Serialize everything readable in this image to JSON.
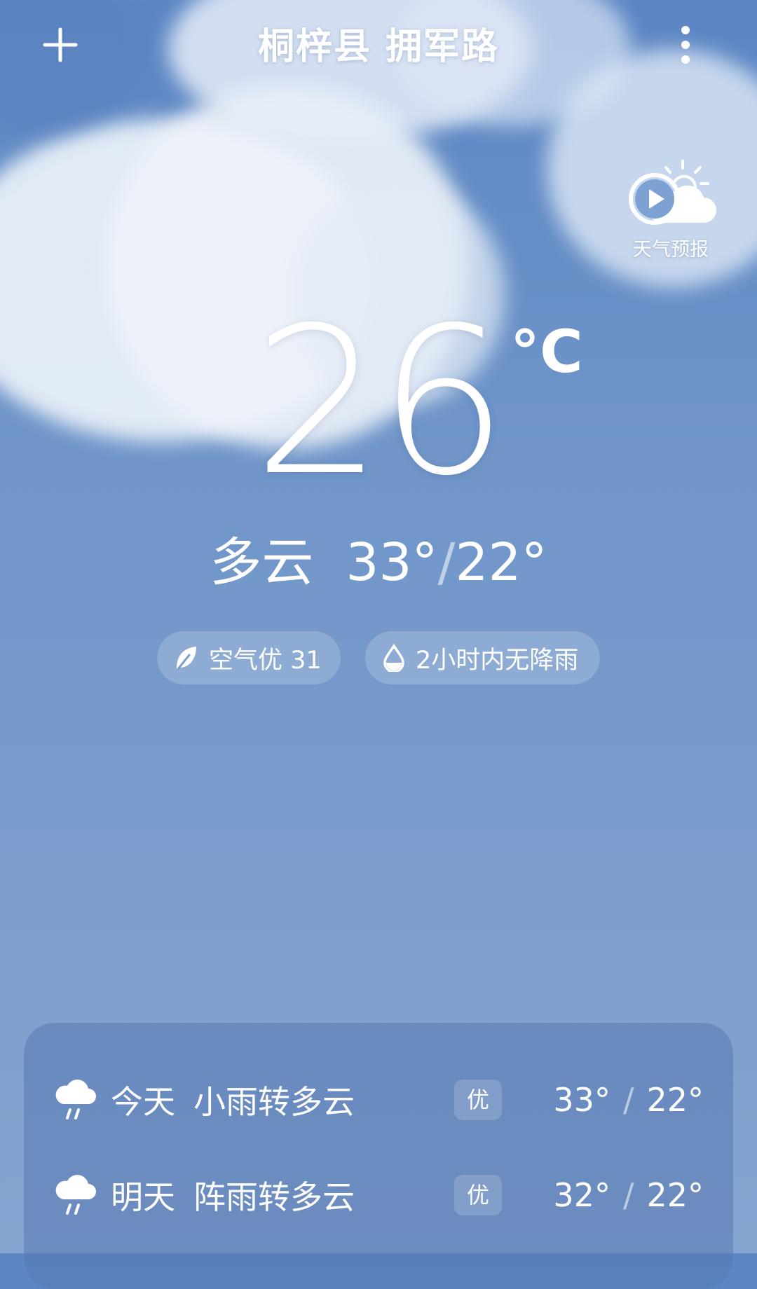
{
  "header": {
    "location": "桐梓县 拥军路",
    "add_icon": "plus-icon",
    "menu_icon": "more-vertical-icon"
  },
  "forecast_video": {
    "label": "天气预报",
    "icon": "play-cloud-sun-icon"
  },
  "current": {
    "temperature": "26",
    "unit": "°C",
    "condition": "多云",
    "high": "33°",
    "low": "22°",
    "separator": "/"
  },
  "chips": {
    "air": {
      "icon": "leaf-icon",
      "text": "空气优 31"
    },
    "rain": {
      "icon": "raindrop-icon",
      "text": "2小时内无降雨"
    }
  },
  "daily": [
    {
      "day": "今天",
      "condition": "小雨转多云",
      "aqi": "优",
      "high": "33°",
      "low": "22°",
      "icon": "rain-cloud-icon"
    },
    {
      "day": "明天",
      "condition": "阵雨转多云",
      "aqi": "优",
      "high": "32°",
      "low": "22°",
      "icon": "rain-cloud-icon"
    }
  ],
  "colors": {
    "sky_top": "#5b86c4",
    "sky_bottom": "#86a4d0",
    "panel": "#587ab2",
    "text": "#ffffff"
  }
}
